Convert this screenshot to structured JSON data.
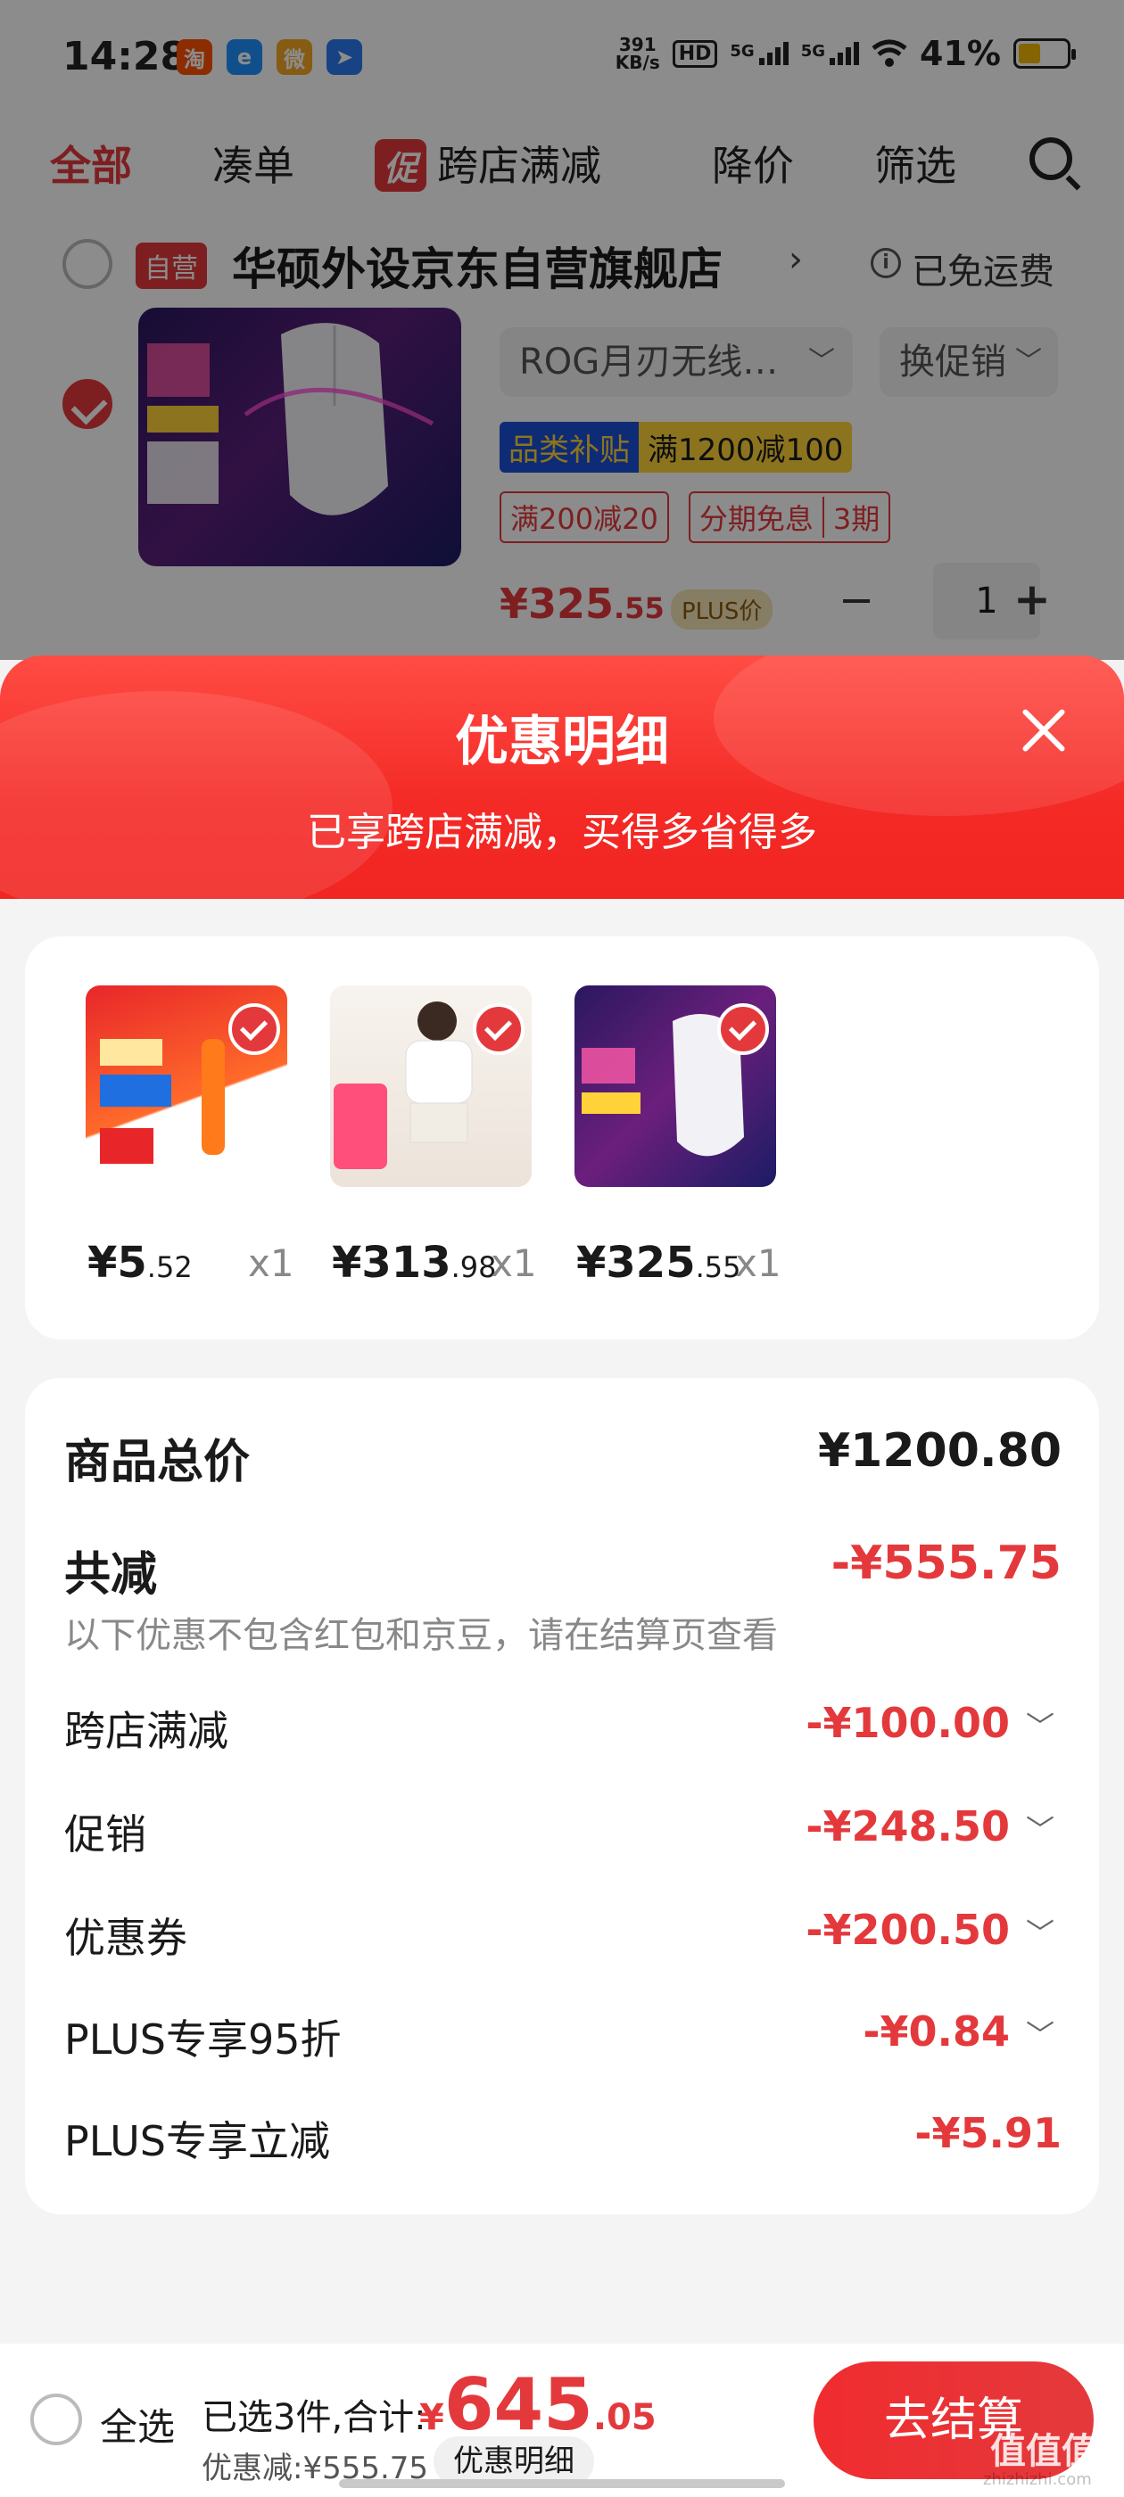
{
  "status_bar": {
    "time": "14:28",
    "app_icons": [
      {
        "name": "taobao-icon",
        "glyph": "淘",
        "color": "#ff5000"
      },
      {
        "name": "browser-icon",
        "glyph": "e",
        "color": "#1e90ff"
      },
      {
        "name": "weibo-icon",
        "glyph": "微",
        "color": "#f5a623"
      },
      {
        "name": "map-icon",
        "glyph": "➤",
        "color": "#2b7bf3"
      }
    ],
    "net_speed_value": "391",
    "net_speed_unit": "KB/s",
    "hd_label": "HD",
    "signal_1": "5G",
    "signal_2": "5G",
    "battery": "41%"
  },
  "tabs": {
    "all": "全部",
    "combine": "凑单",
    "promo_badge": "促",
    "cross_store": "跨店满减",
    "price_drop": "降价",
    "filter": "筛选"
  },
  "store": {
    "badge": "自营",
    "name": "华硕外设京东自营旗舰店",
    "arrow": "›",
    "shipping": "已免运费"
  },
  "product": {
    "variant": "ROG月刃无线…",
    "promo_select": "换促销",
    "tag_subsidy": "品类补贴",
    "tag_discount": "满1200减100",
    "tag_200": "满200减20",
    "tag_installment": "分期免息",
    "tag_installment_n": "3期",
    "price_sym": "¥",
    "price_int": "325",
    "price_dec": ".55",
    "plus_badge": "PLUS价",
    "qty": "1",
    "minus": "−",
    "plus": "+"
  },
  "sheet": {
    "title": "优惠明细",
    "subtitle": "已享跨店满减，买得多省得多"
  },
  "items": [
    {
      "price_int": "¥5",
      "price_dec": ".52",
      "qty": "x1"
    },
    {
      "price_int": "¥313",
      "price_dec": ".98",
      "qty": "x1"
    },
    {
      "price_int": "¥325",
      "price_dec": ".55",
      "qty": "x1"
    }
  ],
  "summary": {
    "total_label": "商品总价",
    "total_value": "¥1200.80",
    "reduce_label": "共减",
    "reduce_value": "-¥555.75",
    "note": "以下优惠不包含红包和京豆，请在结算页查看",
    "lines": [
      {
        "label": "跨店满减",
        "value": "-¥100.00",
        "chevron": "﹀"
      },
      {
        "label": "促销",
        "value": "-¥248.50",
        "chevron": "﹀"
      },
      {
        "label": "优惠券",
        "value": "-¥200.50",
        "chevron": "﹀"
      },
      {
        "label": "PLUS专享95折",
        "value": "-¥0.84",
        "chevron": "﹀"
      },
      {
        "label": "PLUS专享立减",
        "value": "-¥5.91",
        "chevron": ""
      }
    ]
  },
  "bottom": {
    "select_all": "全选",
    "selected": "已选3件,合计:",
    "total_sym": "¥",
    "total_int": "645",
    "total_dec": ".05",
    "saved": "优惠减:¥555.75",
    "detail": "优惠明细",
    "checkout": "去结算"
  },
  "watermark": "值值值",
  "watermark_sub": "zhizhizhi.com",
  "colors": {
    "accent": "#e4393c",
    "sheet_header": "#f42a26",
    "plus_gold": "#f5e3b8",
    "subsidy_blue": "#1a4fd6",
    "subsidy_yellow": "#ffd43a"
  }
}
